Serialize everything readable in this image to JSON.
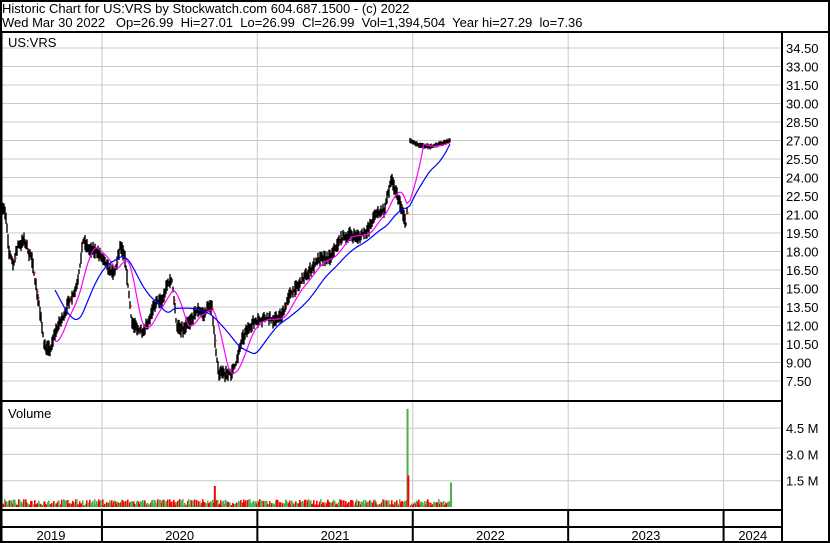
{
  "header": {
    "title": "Historic Chart for US:VRS by Stockwatch.com 604.687.1500 - (c) 2022",
    "quote": "Wed Mar 30 2022   Op=26.99  Hi=27.01  Lo=26.99  Cl=26.99  Vol=1,394,504  Year hi=27.29  lo=7.36"
  },
  "colors": {
    "price": "#000000",
    "down_tick": "#ff0000",
    "ma_short": "#ff00ff",
    "ma_long": "#0000ff",
    "vol_up": "#4caf50",
    "vol_down": "#ff0000",
    "grid": "#c8c8c8"
  },
  "chart_data": {
    "type": "line",
    "symbol_label": "US:VRS",
    "volume_label": "Volume",
    "x_unit": "year",
    "xlim": [
      2019.344,
      2024.376
    ],
    "x_ticks": [
      "2019",
      "2020",
      "2021",
      "2022",
      "2023",
      "2024"
    ],
    "ylim": [
      6.5,
      35.5
    ],
    "y_ticks": [
      7.5,
      9.0,
      10.5,
      12.0,
      13.5,
      15.0,
      16.5,
      18.0,
      19.5,
      21.0,
      22.5,
      24.0,
      25.5,
      27.0,
      28.5,
      30.0,
      31.5,
      33.0,
      34.5
    ],
    "y_tick_labels": [
      "7.50",
      "9.00",
      "10.50",
      "12.00",
      "13.50",
      "15.00",
      "16.50",
      "18.00",
      "19.50",
      "21.00",
      "22.50",
      "24.00",
      "25.50",
      "27.00",
      "28.50",
      "30.00",
      "31.50",
      "33.00",
      "34.50"
    ],
    "price": [
      [
        2019.34,
        22.2
      ],
      [
        2019.38,
        21.0
      ],
      [
        2019.4,
        18.1
      ],
      [
        2019.43,
        16.9
      ],
      [
        2019.46,
        18.5
      ],
      [
        2019.5,
        18.9
      ],
      [
        2019.55,
        17.3
      ],
      [
        2019.59,
        14.1
      ],
      [
        2019.63,
        10.4
      ],
      [
        2019.67,
        10.0
      ],
      [
        2019.7,
        11.6
      ],
      [
        2019.74,
        12.4
      ],
      [
        2019.78,
        13.7
      ],
      [
        2019.83,
        14.9
      ],
      [
        2019.86,
        16.9
      ],
      [
        2019.88,
        18.9
      ],
      [
        2019.92,
        18.1
      ],
      [
        2019.97,
        18.1
      ],
      [
        2020.02,
        16.9
      ],
      [
        2020.08,
        16.1
      ],
      [
        2020.12,
        18.5
      ],
      [
        2020.15,
        17.3
      ],
      [
        2020.17,
        14.9
      ],
      [
        2020.19,
        12.4
      ],
      [
        2020.23,
        11.6
      ],
      [
        2020.26,
        11.6
      ],
      [
        2020.3,
        12.4
      ],
      [
        2020.34,
        13.7
      ],
      [
        2020.39,
        14.1
      ],
      [
        2020.42,
        15.3
      ],
      [
        2020.45,
        15.7
      ],
      [
        2020.46,
        14.5
      ],
      [
        2020.48,
        12.0
      ],
      [
        2020.52,
        11.6
      ],
      [
        2020.57,
        12.4
      ],
      [
        2020.62,
        13.3
      ],
      [
        2020.66,
        12.9
      ],
      [
        2020.69,
        13.7
      ],
      [
        2020.71,
        13.3
      ],
      [
        2020.73,
        10.4
      ],
      [
        2020.75,
        8.2
      ],
      [
        2020.79,
        8.0
      ],
      [
        2020.84,
        8.2
      ],
      [
        2020.87,
        9.2
      ],
      [
        2020.9,
        10.8
      ],
      [
        2020.95,
        12.0
      ],
      [
        2021.0,
        12.4
      ],
      [
        2021.05,
        12.6
      ],
      [
        2021.11,
        12.4
      ],
      [
        2021.16,
        12.9
      ],
      [
        2021.21,
        14.5
      ],
      [
        2021.27,
        15.3
      ],
      [
        2021.34,
        16.5
      ],
      [
        2021.39,
        17.3
      ],
      [
        2021.47,
        17.5
      ],
      [
        2021.53,
        18.9
      ],
      [
        2021.59,
        19.4
      ],
      [
        2021.66,
        19.2
      ],
      [
        2021.72,
        19.9
      ],
      [
        2021.76,
        21.0
      ],
      [
        2021.82,
        21.4
      ],
      [
        2021.86,
        23.8
      ],
      [
        2021.9,
        22.6
      ],
      [
        2021.93,
        21.4
      ],
      [
        2021.96,
        20.1
      ],
      [
        2021.98,
        27.0
      ],
      [
        2022.04,
        26.6
      ],
      [
        2022.11,
        26.5
      ],
      [
        2022.17,
        26.7
      ],
      [
        2022.24,
        26.99
      ]
    ],
    "volume_ylim": [
      0,
      5.7
    ],
    "volume_ticks": [
      1.5,
      3.0,
      4.5
    ],
    "volume_tick_labels": [
      "1.5 M",
      "3.0 M",
      "4.5 M"
    ],
    "volume_typical_millions": 0.3,
    "volume_spikes": [
      [
        2020.72,
        1.2,
        "down"
      ],
      [
        2021.96,
        5.6,
        "up"
      ],
      [
        2021.965,
        1.8,
        "down"
      ],
      [
        2022.24,
        1.4,
        "up"
      ]
    ]
  }
}
